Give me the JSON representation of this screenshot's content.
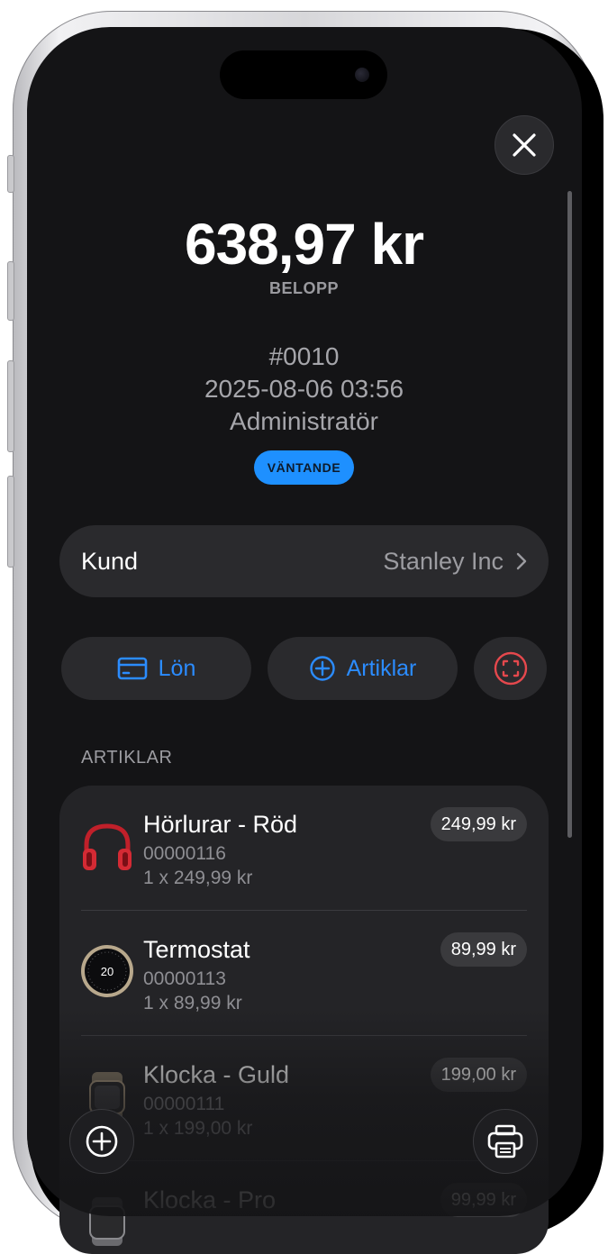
{
  "header": {
    "amount": "638,97 kr",
    "amount_label": "BELOPP",
    "order_number": "#0010",
    "datetime": "2025-08-06 03:56",
    "user": "Administratör",
    "status_badge": "VÄNTANDE"
  },
  "customer": {
    "label": "Kund",
    "value": "Stanley Inc"
  },
  "actions": {
    "pay_label": "Lön",
    "add_items_label": "Artiklar"
  },
  "section_title": "ARTIKLAR",
  "items": [
    {
      "name": "Hörlurar - Röd",
      "sku": "00000116",
      "qty": "1 x 249,99 kr",
      "price": "249,99 kr",
      "icon": "headphones-icon"
    },
    {
      "name": "Termostat",
      "sku": "00000113",
      "qty": "1 x 89,99 kr",
      "price": "89,99 kr",
      "icon": "thermostat-icon",
      "thumb_text": "20"
    },
    {
      "name": "Klocka - Guld",
      "sku": "00000111",
      "qty": "1 x 199,00 kr",
      "price": "199,00 kr",
      "icon": "watch-icon"
    },
    {
      "name": "Klocka - Pro",
      "price": "99,99 kr",
      "icon": "watch-icon"
    }
  ],
  "colors": {
    "accent": "#1e90ff",
    "scan_button": "#e5484d",
    "background": "#141416",
    "card": "#2a2a2d"
  },
  "icons": {
    "close": "close-icon",
    "chevron": "chevron-right-icon",
    "pay": "credit-card-icon",
    "add": "plus-circle-icon",
    "scan": "scan-icon",
    "print": "printer-icon"
  }
}
